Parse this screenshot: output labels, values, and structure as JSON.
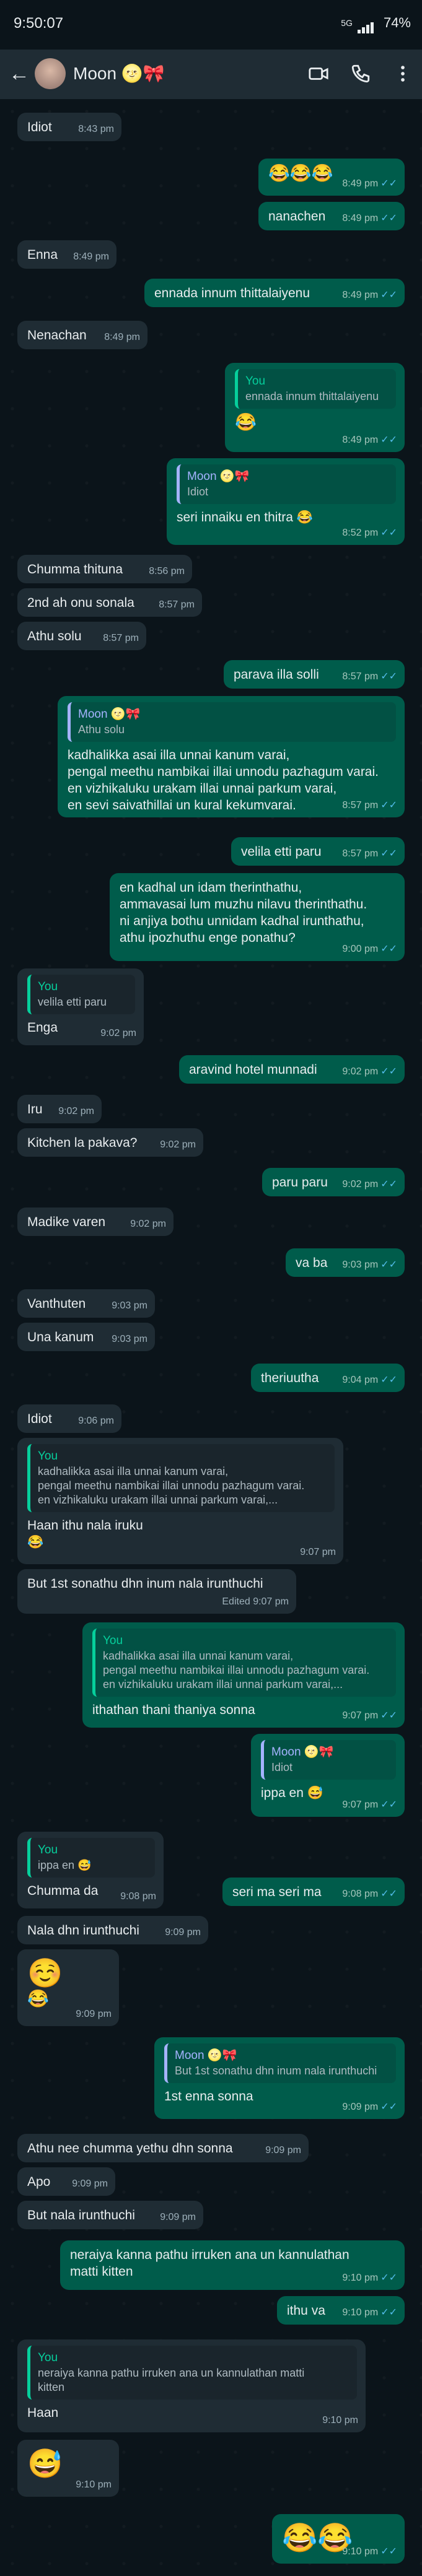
{
  "status_bar": {
    "time": "9:50:07",
    "signal": "5G",
    "battery": "74%"
  },
  "header": {
    "contact_name": "Moon 🌝🎀"
  },
  "messages": {
    "m1": {
      "text": "Idiot",
      "time": "8:43 pm"
    },
    "m2": {
      "text": "😂😂😂",
      "time": "8:49 pm"
    },
    "m3": {
      "text": "nanachen",
      "time": "8:49 pm"
    },
    "m4": {
      "text": "Enna",
      "time": "8:49 pm"
    },
    "m5": {
      "text": "ennada innum thittalaiyenu",
      "time": "8:49 pm"
    },
    "m6": {
      "text": "Nenachan",
      "time": "8:49 pm"
    },
    "m7": {
      "quote_name": "You",
      "quote_text": "ennada innum thittalaiyenu",
      "text": "😂",
      "time": "8:49 pm"
    },
    "m8": {
      "quote_name": "Moon 🌝🎀",
      "quote_text": "Idiot",
      "text": "seri innaiku en thitra 😂",
      "time": "8:52 pm"
    },
    "m9": {
      "text": "Chumma thituna",
      "time": "8:56 pm"
    },
    "m10": {
      "text": "2nd ah onu sonala",
      "time": "8:57 pm"
    },
    "m11": {
      "text": "Athu solu",
      "time": "8:57 pm"
    },
    "m12": {
      "text": "parava illa solli",
      "time": "8:57 pm"
    },
    "m13": {
      "quote_name": "Moon 🌝🎀",
      "quote_text": "Athu solu",
      "text": "kadhalikka asai illa unnai kanum varai,\npengal meethu nambikai illai unnodu pazhagum varai.\nen vizhikaluku urakam illai unnai parkum varai,\nen sevi saivathillai un kural kekumvarai.",
      "time": "8:57 pm"
    },
    "m14": {
      "text": "velila etti paru",
      "time": "8:57 pm"
    },
    "m15": {
      "text": "en kadhal un idam therinthathu,\nammavasai lum muzhu nilavu therinthathu.\nni anjiya bothu unnidam kadhal irunthathu,\nathu ipozhuthu enge ponathu?",
      "time": "9:00 pm"
    },
    "m16": {
      "quote_name": "You",
      "quote_text": "velila etti paru",
      "text": "Enga",
      "time": "9:02 pm"
    },
    "m17": {
      "text": "aravind hotel munnadi",
      "time": "9:02 pm"
    },
    "m18": {
      "text": "Iru",
      "time": "9:02 pm"
    },
    "m19": {
      "text": "Kitchen la pakava?",
      "time": "9:02 pm"
    },
    "m20": {
      "text": "paru paru",
      "time": "9:02 pm"
    },
    "m21": {
      "text": "Madike varen",
      "time": "9:02 pm"
    },
    "m22": {
      "text": "va ba",
      "time": "9:03 pm"
    },
    "m23": {
      "text": "Vanthuten",
      "time": "9:03 pm"
    },
    "m24": {
      "text": "Una kanum",
      "time": "9:03 pm"
    },
    "m25": {
      "text": "theriuutha",
      "time": "9:04 pm"
    },
    "m26": {
      "text": "Idiot",
      "time": "9:06 pm"
    },
    "m27": {
      "quote_name": "You",
      "quote_text": "kadhalikka asai illa unnai kanum varai,\npengal meethu nambikai illai unnodu pazhagum varai.\nen vizhikaluku urakam illai unnai parkum varai,...",
      "text": "Haan ithu nala iruku\n😂",
      "time": "9:07 pm"
    },
    "m28": {
      "text": "But 1st sonathu dhn inum nala irunthuchi",
      "time": "Edited 9:07 pm"
    },
    "m29": {
      "quote_name": "You",
      "quote_text": "kadhalikka asai illa unnai kanum varai,\npengal meethu nambikai illai unnodu pazhagum varai.\nen vizhikaluku urakam illai unnai parkum varai,...",
      "text": "ithathan thani thaniya sonna",
      "time": "9:07 pm"
    },
    "m30": {
      "quote_name": "Moon 🌝🎀",
      "quote_text": "Idiot",
      "text": "ippa en 😅",
      "time": "9:07 pm"
    },
    "m31": {
      "quote_name": "You",
      "quote_text": "ippa en 😅",
      "text": "Chumma da",
      "time": "9:08 pm"
    },
    "m32": {
      "text": "seri ma seri ma",
      "time": "9:08 pm"
    },
    "m33": {
      "text": "Nala dhn irunthuchi",
      "time": "9:09 pm"
    },
    "m34": {
      "text": "☺️",
      "text2": "😂",
      "time": "9:09 pm"
    },
    "m35": {
      "quote_name": "Moon 🌝🎀",
      "quote_text": "But 1st sonathu dhn inum nala irunthuchi",
      "text": "1st enna sonna",
      "time": "9:09 pm"
    },
    "m36": {
      "text": "Athu nee chumma yethu dhn sonna",
      "time": "9:09 pm"
    },
    "m37": {
      "text": "Apo",
      "time": "9:09 pm"
    },
    "m38": {
      "text": "But nala irunthuchi",
      "time": "9:09 pm"
    },
    "m39": {
      "text": "neraiya kanna pathu irruken ana un kannulathan\nmatti kitten",
      "time": "9:10 pm"
    },
    "m40": {
      "text": "ithu va",
      "time": "9:10 pm"
    },
    "m41": {
      "quote_name": "You",
      "quote_text": "neraiya kanna pathu irruken ana un kannulathan matti\nkitten",
      "text": "Haan",
      "time": "9:10 pm"
    },
    "m42": {
      "text": "😅",
      "time": "9:10 pm"
    },
    "m43": {
      "text": "😂😂",
      "time": "9:10 pm"
    }
  }
}
